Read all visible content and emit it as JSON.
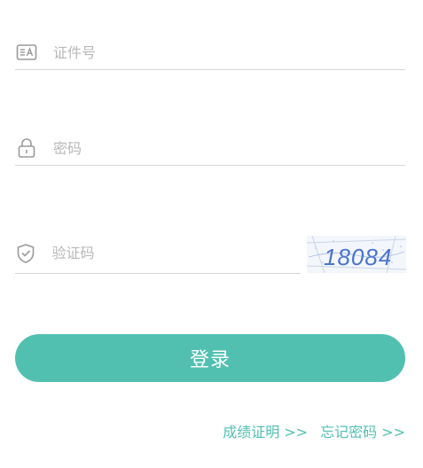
{
  "form": {
    "id_number": {
      "placeholder": "证件号",
      "value": ""
    },
    "password": {
      "placeholder": "密码",
      "value": ""
    },
    "captcha": {
      "placeholder": "验证码",
      "value": "",
      "image_text": "18084"
    }
  },
  "login_button": {
    "label": "登录"
  },
  "links": {
    "score_certificate": "成绩证明 >>",
    "forgot_password": "忘记密码 >>"
  },
  "colors": {
    "accent": "#52c0b1",
    "placeholder": "#b8b8b8",
    "underline": "#d6d6d6",
    "icon": "#9a9a9a",
    "captcha_text": "#4a74cf"
  },
  "icons": {
    "id": "id-card-icon",
    "password": "lock-icon",
    "captcha": "shield-check-icon"
  }
}
